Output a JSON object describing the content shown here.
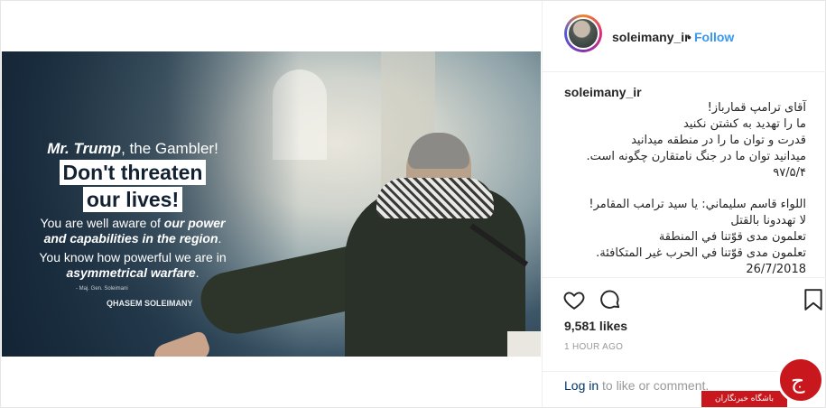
{
  "post": {
    "username": "soleimany_ir",
    "separator": "•",
    "follow_label": "Follow",
    "image": {
      "line1_prefix": "Mr. Trump",
      "line1_suffix": ", the Gambler!",
      "headline1": "Don't threaten",
      "headline2": "our lives!",
      "body1": "You are well aware of ",
      "body1_bold": "our power and capabilities in the region",
      "body1_end": ".",
      "body2": "You know how powerful we are in ",
      "body2_bold": "asymmetrical warfare",
      "body2_end": ".",
      "signature": "- Maj. Gen. Soleimani",
      "logo": "QHASEM SOLEIMANY"
    },
    "caption": {
      "username": "soleimany_ir",
      "persian_lines": [
        "آقای ترامپ قمارباز!",
        "ما را تهدید به کشتن نکنید",
        "قدرت و توان ما را در منطقه میدانید",
        "میدانید توان ما در جنگ نامتقارن چگونه است.",
        "۹۷/۵/۴"
      ],
      "arabic_lines": [
        "اللواء قاسم سليماني: يا سيد ترامب المقامر!",
        "لا تهددونا بالقتل",
        "تعلمون مدى قوّتنا في المنطقة",
        "تعلمون مدى قوّتنا في الحرب غير المتكافئة.",
        "26/7/2018"
      ]
    },
    "icons": {
      "like": "heart-icon",
      "comment": "comment-icon",
      "save": "bookmark-icon"
    },
    "likes": "9,581 likes",
    "time": "1 HOUR AGO",
    "login_link": "Log in",
    "login_rest": " to like or comment."
  },
  "watermark": {
    "text": "باشگاه خبرنگاران"
  },
  "colors": {
    "link_blue": "#3897f0",
    "watermark_red": "#c8181e",
    "text": "#262626"
  }
}
